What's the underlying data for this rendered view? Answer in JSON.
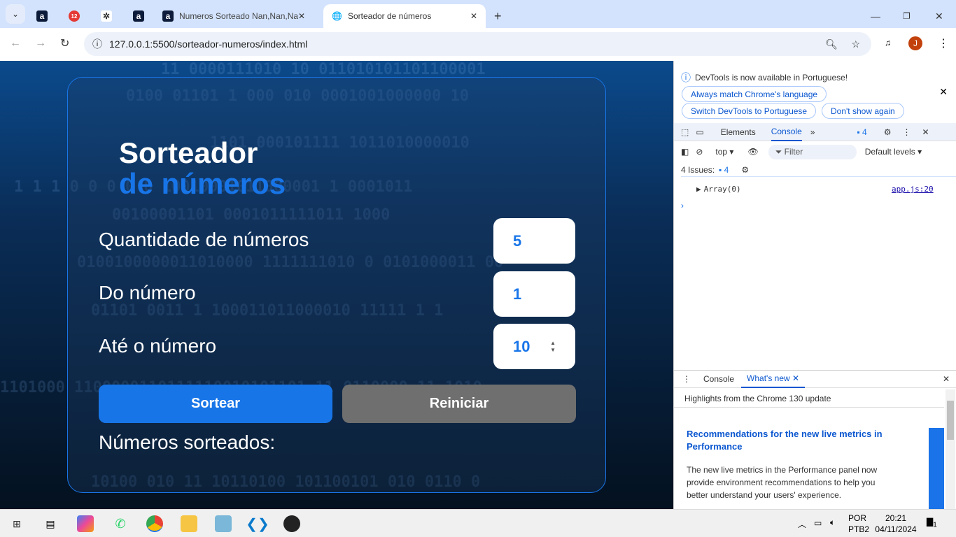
{
  "browser": {
    "tabs": [
      {
        "label": "",
        "icon": "a"
      },
      {
        "label": "",
        "icon": "12"
      },
      {
        "label": "",
        "icon": "openai"
      },
      {
        "label": "",
        "icon": "a"
      },
      {
        "label": "Numeros Sorteado Nan,Nan,Na",
        "icon": "a"
      }
    ],
    "active_tab": "Sorteador de números",
    "url": "127.0.0.1:5500/sorteador-numeros/index.html",
    "profile": "J"
  },
  "app": {
    "title_line1": "Sorteador",
    "title_line2": "de números",
    "fields": [
      {
        "label": "Quantidade de números",
        "value": "5"
      },
      {
        "label": "Do número",
        "value": "1"
      },
      {
        "label": "Até o número",
        "value": "10"
      }
    ],
    "sortear": "Sortear",
    "reiniciar": "Reiniciar",
    "result_label": "Números sorteados:",
    "colors": {
      "accent": "#1875e8",
      "secondary": "#6f6f6f"
    }
  },
  "devtools": {
    "banner": "DevTools is now available in Portuguese!",
    "btn_match": "Always match Chrome's language",
    "btn_switch": "Switch DevTools to Portuguese",
    "btn_dont": "Don't show again",
    "tab_elements": "Elements",
    "tab_console": "Console",
    "badge": "4",
    "context": "top",
    "filter_placeholder": "Filter",
    "levels": "Default levels",
    "issues": "4 Issues:",
    "issues_count": "4",
    "log_text": "Array(0)",
    "log_source": "app.js:20",
    "drawer_console": "Console",
    "drawer_whatsnew": "What's new",
    "highlights": "Highlights from the Chrome 130 update",
    "article_title": "Recommendations for the new live metrics in Performance",
    "article_body": "The new live metrics in the Performance panel now provide environment recommendations to help you better understand your users' experience."
  },
  "taskbar": {
    "lang1": "POR",
    "lang2": "PTB2",
    "time": "20:21",
    "date": "04/11/2024",
    "notifications": "1"
  }
}
